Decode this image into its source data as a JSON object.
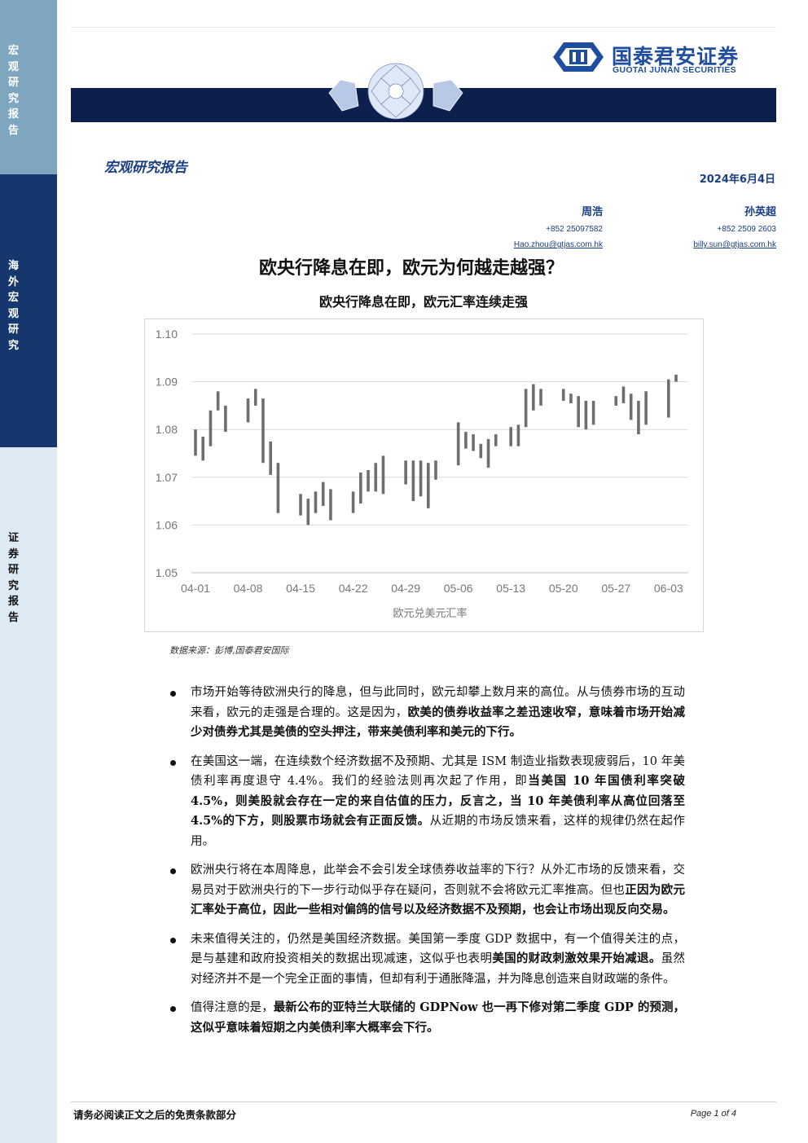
{
  "sidebar": {
    "sections": [
      {
        "label": "宏观研究报告",
        "color": "#7fa6bf"
      },
      {
        "label": "海外宏观研究",
        "color": "#15376e"
      },
      {
        "label": "证券研究报告",
        "color": "#dde9f3"
      }
    ]
  },
  "header": {
    "logo_cn": "国泰君安证券",
    "logo_en": "GUOTAI JUNAN SECURITIES",
    "brand_color": "#1f4e9e",
    "banner_color": "#0d1f4d"
  },
  "report": {
    "type": "宏观研究报告",
    "date": "2024年6月4日",
    "authors": [
      {
        "name": "周浩",
        "phone": "+852 25097582",
        "email": "Hao.zhou@gtjas.com.hk"
      },
      {
        "name": "孙英超",
        "phone": "+852 2509 2603",
        "email": "billy.sun@gtjas.com.hk"
      }
    ],
    "title": "欧央行降息在即，欧元为何越走越强？"
  },
  "chart_data": {
    "type": "candlestick",
    "title": "欧央行降息在即，欧元汇率连续走强",
    "xlabel": "欧元兑美元汇率",
    "ylim": [
      1.05,
      1.1
    ],
    "yticks": [
      "1.10",
      "1.09",
      "1.08",
      "1.07",
      "1.06",
      "1.05"
    ],
    "xticks": [
      "04-01",
      "04-08",
      "04-15",
      "04-22",
      "04-29",
      "05-06",
      "05-13",
      "05-20",
      "05-27",
      "06-03"
    ],
    "grid": true,
    "bar_color": "#6e6e6e",
    "bars": [
      {
        "x": 0,
        "low": 1.0745,
        "high": 1.08
      },
      {
        "x": 1,
        "low": 1.0735,
        "high": 1.0785
      },
      {
        "x": 2,
        "low": 1.0765,
        "high": 1.084
      },
      {
        "x": 3,
        "low": 1.084,
        "high": 1.088
      },
      {
        "x": 4,
        "low": 1.0795,
        "high": 1.085
      },
      {
        "x": 7,
        "low": 1.0815,
        "high": 1.0865
      },
      {
        "x": 8,
        "low": 1.085,
        "high": 1.0885
      },
      {
        "x": 9,
        "low": 1.073,
        "high": 1.0865
      },
      {
        "x": 10,
        "low": 1.0705,
        "high": 1.0775
      },
      {
        "x": 11,
        "low": 1.0625,
        "high": 1.073
      },
      {
        "x": 14,
        "low": 1.062,
        "high": 1.0665
      },
      {
        "x": 15,
        "low": 1.06,
        "high": 1.0655
      },
      {
        "x": 16,
        "low": 1.0625,
        "high": 1.067
      },
      {
        "x": 17,
        "low": 1.064,
        "high": 1.069
      },
      {
        "x": 18,
        "low": 1.061,
        "high": 1.0675
      },
      {
        "x": 21,
        "low": 1.0625,
        "high": 1.067
      },
      {
        "x": 22,
        "low": 1.0645,
        "high": 1.071
      },
      {
        "x": 23,
        "low": 1.067,
        "high": 1.0715
      },
      {
        "x": 24,
        "low": 1.067,
        "high": 1.073
      },
      {
        "x": 25,
        "low": 1.0665,
        "high": 1.0745
      },
      {
        "x": 28,
        "low": 1.0685,
        "high": 1.0735
      },
      {
        "x": 29,
        "low": 1.065,
        "high": 1.0735
      },
      {
        "x": 30,
        "low": 1.066,
        "high": 1.0735
      },
      {
        "x": 31,
        "low": 1.0635,
        "high": 1.073
      },
      {
        "x": 32,
        "low": 1.0695,
        "high": 1.0735
      },
      {
        "x": 35,
        "low": 1.0725,
        "high": 1.0815
      },
      {
        "x": 36,
        "low": 1.076,
        "high": 1.0795
      },
      {
        "x": 37,
        "low": 1.0755,
        "high": 1.079
      },
      {
        "x": 38,
        "low": 1.074,
        "high": 1.077
      },
      {
        "x": 39,
        "low": 1.072,
        "high": 1.078
      },
      {
        "x": 40,
        "low": 1.0765,
        "high": 1.079
      },
      {
        "x": 42,
        "low": 1.0765,
        "high": 1.0805
      },
      {
        "x": 43,
        "low": 1.0765,
        "high": 1.081
      },
      {
        "x": 44,
        "low": 1.0805,
        "high": 1.0885
      },
      {
        "x": 45,
        "low": 1.084,
        "high": 1.0895
      },
      {
        "x": 46,
        "low": 1.085,
        "high": 1.0885
      },
      {
        "x": 49,
        "low": 1.086,
        "high": 1.0885
      },
      {
        "x": 50,
        "low": 1.0855,
        "high": 1.0875
      },
      {
        "x": 51,
        "low": 1.0805,
        "high": 1.087
      },
      {
        "x": 52,
        "low": 1.08,
        "high": 1.086
      },
      {
        "x": 53,
        "low": 1.081,
        "high": 1.086
      },
      {
        "x": 56,
        "low": 1.085,
        "high": 1.087
      },
      {
        "x": 57,
        "low": 1.0855,
        "high": 1.089
      },
      {
        "x": 58,
        "low": 1.082,
        "high": 1.0875
      },
      {
        "x": 59,
        "low": 1.079,
        "high": 1.086
      },
      {
        "x": 60,
        "low": 1.081,
        "high": 1.088
      },
      {
        "x": 63,
        "low": 1.0825,
        "high": 1.0905
      },
      {
        "x": 64,
        "low": 1.09,
        "high": 1.0915
      }
    ]
  },
  "source": "数据来源：彭博,国泰君安国际",
  "bullets": [
    [
      {
        "text": "市场开始等待欧洲央行的降息，但与此同时，欧元却攀上数月来的高位。从与债券市场的互动来看，欧元的走强是合理的。这是因为，",
        "bold": false
      },
      {
        "text": "欧美的债券收益率之差迅速收窄，意味着市场开始减少对债券尤其是美债的空头押注，带来美债利率和美元的下行。",
        "bold": true
      }
    ],
    [
      {
        "text": "在美国这一端，在连续数个经济数据不及预期、尤其是 ISM 制造业指数表现疲弱后，10 年美债利率再度退守 4.4%。我们的经验法则再次起了作用，即",
        "bold": false
      },
      {
        "text": "当美国 10 年国债利率突破 4.5%，则美股就会存在一定的来自估值的压力，反言之，当 10 年美债利率从高位回落至 4.5%的下方，则股票市场就会有正面反馈。",
        "bold": true
      },
      {
        "text": "从近期的市场反馈来看，这样的规律仍然在起作用。",
        "bold": false
      }
    ],
    [
      {
        "text": "欧洲央行将在本周降息，此举会不会引发全球债券收益率的下行？从外汇市场的反馈来看，交易员对于欧洲央行的下一步行动似乎存在疑问，否则就不会将欧元汇率推高。但也",
        "bold": false
      },
      {
        "text": "正因为欧元汇率处于高位，因此一些相对偏鸽的信号以及经济数据不及预期，也会让市场出现反向交易。",
        "bold": true
      }
    ],
    [
      {
        "text": "未来值得关注的，仍然是美国经济数据。美国第一季度 GDP 数据中，有一个值得关注的点，是与基建和政府投资相关的数据出现减速，这似乎也表明",
        "bold": false
      },
      {
        "text": "美国的财政刺激效果开始减退。",
        "bold": true
      },
      {
        "text": "虽然对经济并不是一个完全正面的事情，但却有利于通胀降温，并为降息创造来自财政端的条件。",
        "bold": false
      }
    ],
    [
      {
        "text": "值得注意的是，",
        "bold": false
      },
      {
        "text": "最新公布的亚特兰大联储的 GDPNow 也一再下修对第二季度 GDP 的预测，这似乎意味着短期之内美债利率大概率会下行。",
        "bold": true
      }
    ]
  ],
  "footer": {
    "disclaimer": "请务必阅读正文之后的免责条款部分",
    "page": "Page 1 of 4"
  }
}
